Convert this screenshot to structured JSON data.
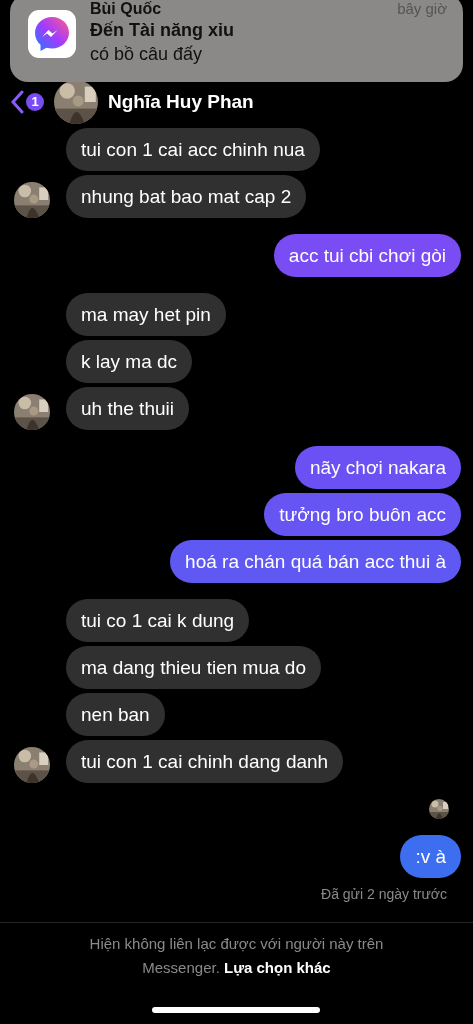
{
  "notification": {
    "sender": "Bùi Quốc",
    "time": "bây giờ",
    "title": "Đến Tài năng xỉu",
    "body": "có bồ câu đấy"
  },
  "header": {
    "unread": "1",
    "name": "Nghĩa Huy Phan"
  },
  "groups": [
    {
      "kind": "received",
      "messages": [
        {
          "text": "tui con 1 cai acc chinh nua"
        },
        {
          "text": "nhung bat bao mat cap 2"
        }
      ]
    },
    {
      "kind": "sent",
      "messages": [
        {
          "text": "acc tui cbi chơi gòi",
          "color": "#7a4cf4"
        }
      ]
    },
    {
      "kind": "received",
      "messages": [
        {
          "text": "ma may het pin"
        },
        {
          "text": "k lay ma dc"
        },
        {
          "text": "uh the thuii"
        }
      ]
    },
    {
      "kind": "sent",
      "messages": [
        {
          "text": "nãy chơi nakara",
          "color": "#6b51f3"
        },
        {
          "text": "tưởng bro buôn acc",
          "color": "#6655f3"
        },
        {
          "text": "hoá ra chán quá bán acc thui à",
          "color": "#6058f2"
        }
      ]
    },
    {
      "kind": "received",
      "messages": [
        {
          "text": "tui co 1 cai k dung"
        },
        {
          "text": "ma dang thieu tien mua do"
        },
        {
          "text": "nen ban"
        },
        {
          "text": "tui con 1 cai chinh dang danh"
        }
      ]
    },
    {
      "kind": "seen"
    },
    {
      "kind": "sent",
      "messages": [
        {
          "text": ":v à",
          "color": "#3e6ef0"
        }
      ]
    },
    {
      "kind": "status",
      "text": "Đã gửi 2 ngày trước"
    }
  ],
  "footer": {
    "notice": "Hiện không liên lạc được với người này trên Messenger.",
    "link": "Lựa chọn khác"
  }
}
